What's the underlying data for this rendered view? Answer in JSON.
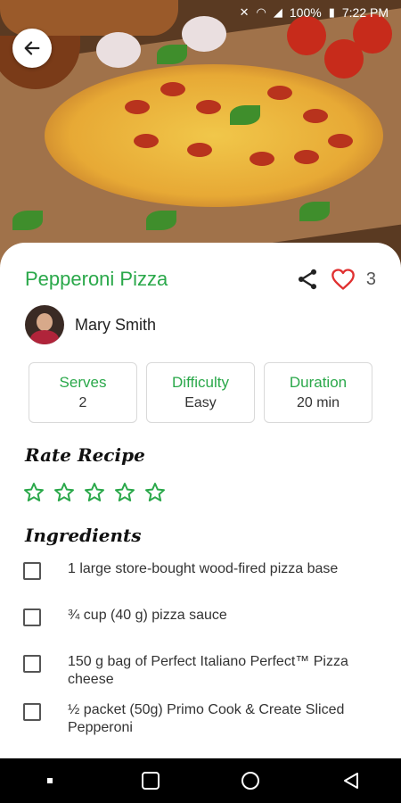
{
  "status_bar": {
    "battery": "100%",
    "time": "7:22 PM"
  },
  "recipe": {
    "title": "Pepperoni Pizza",
    "like_count": "3",
    "author": "Mary Smith",
    "info": [
      {
        "label": "Serves",
        "value": "2"
      },
      {
        "label": "Difficulty",
        "value": "Easy"
      },
      {
        "label": "Duration",
        "value": "20 min"
      }
    ],
    "rating_heading": "Rate Recipe",
    "rating_value": 0,
    "rating_max": 5,
    "ingredients_heading": "Ingredients",
    "ingredients": [
      "1 large store-bought wood-fired pizza base",
      "¾ cup (40 g) pizza sauce",
      "150 g bag of Perfect Italiano Perfect™ Pizza cheese",
      "½ packet (50g) Primo Cook & Create Sliced Pepperoni"
    ]
  },
  "colors": {
    "accent": "#2aa84a",
    "heart": "#e03030"
  },
  "icons": {
    "back": "arrow-left-icon",
    "share": "share-icon",
    "like": "heart-icon",
    "star": "star-outline-icon"
  }
}
